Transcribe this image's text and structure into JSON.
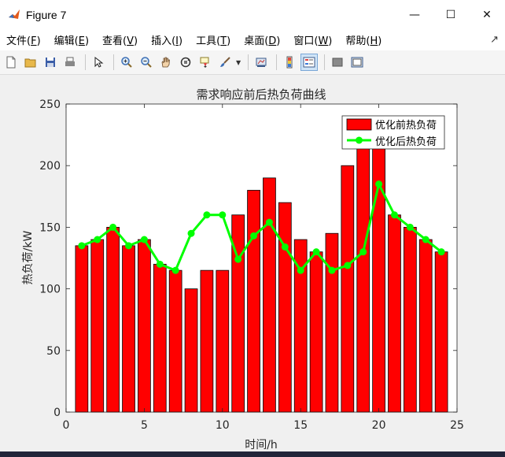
{
  "window": {
    "title": "Figure 7",
    "controls": {
      "minimize": "—",
      "maximize": "☐",
      "close": "✕"
    }
  },
  "menu": {
    "items": [
      {
        "label": "文件(",
        "key": "F",
        "end": ")"
      },
      {
        "label": "编辑(",
        "key": "E",
        "end": ")"
      },
      {
        "label": "查看(",
        "key": "V",
        "end": ")"
      },
      {
        "label": "插入(",
        "key": "I",
        "end": ")"
      },
      {
        "label": "工具(",
        "key": "T",
        "end": ")"
      },
      {
        "label": "桌面(",
        "key": "D",
        "end": ")"
      },
      {
        "label": "窗口(",
        "key": "W",
        "end": ")"
      },
      {
        "label": "帮助(",
        "key": "H",
        "end": ")"
      }
    ],
    "end_glyph": "↗"
  },
  "toolbar": {
    "icons": [
      "new-figure-icon",
      "open-file-icon",
      "save-icon",
      "print-icon",
      "pointer-icon",
      "zoom-in-icon",
      "zoom-out-icon",
      "pan-icon",
      "rotate-3d-icon",
      "data-cursor-icon",
      "brush-icon",
      "link-plot-icon",
      "colorbar-icon",
      "legend-icon",
      "hide-plot-tools-icon",
      "show-plot-tools-icon"
    ]
  },
  "chart_data": {
    "type": "bar",
    "title": "需求响应前后热负荷曲线",
    "xlabel": "时间/h",
    "ylabel": "热负荷/kW",
    "xlim": [
      0,
      25
    ],
    "ylim": [
      0,
      250
    ],
    "xticks": [
      0,
      5,
      10,
      15,
      20,
      25
    ],
    "yticks": [
      0,
      50,
      100,
      150,
      200,
      250
    ],
    "grid": false,
    "legend_position": "top-right",
    "colors": {
      "bar": "#ff0000",
      "line": "#00ff00",
      "edge": "#000000"
    },
    "x": [
      1,
      2,
      3,
      4,
      5,
      6,
      7,
      8,
      9,
      10,
      11,
      12,
      13,
      14,
      15,
      16,
      17,
      18,
      19,
      20,
      21,
      22,
      23,
      24
    ],
    "series": [
      {
        "name": "优化前热负荷",
        "kind": "bar",
        "values": [
          135,
          140,
          150,
          135,
          140,
          120,
          115,
          100,
          115,
          115,
          160,
          180,
          190,
          170,
          140,
          130,
          145,
          200,
          215,
          215,
          160,
          150,
          140,
          130
        ]
      },
      {
        "name": "优化后热负荷",
        "kind": "line",
        "values": [
          135,
          140,
          150,
          135,
          140,
          120,
          115,
          145,
          160,
          160,
          124,
          143,
          154,
          134,
          115,
          130,
          115,
          119,
          130,
          185,
          160,
          150,
          140,
          130
        ]
      }
    ]
  }
}
